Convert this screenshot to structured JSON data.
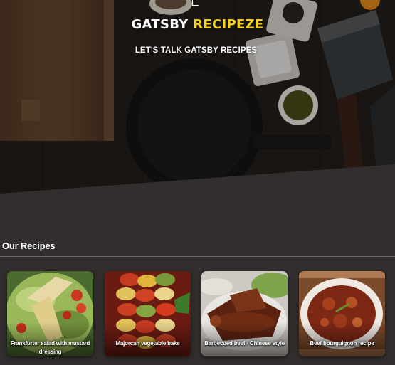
{
  "hero": {
    "title_part1": "GATSBY",
    "title_part2": "RECIPEZE",
    "subtitle": "LET'S TALK GATSBY RECIPES",
    "colors": {
      "accent": "#f6d21c",
      "background": "#312e2d"
    }
  },
  "recipes": {
    "heading": "Our Recipes",
    "items": [
      {
        "label": "Frankfurter salad with mustard dressing"
      },
      {
        "label": "Majorcan vegetable bake"
      },
      {
        "label": "Barbecued beef - Chinese style"
      },
      {
        "label": "Beef bourguignon recipe"
      }
    ]
  }
}
